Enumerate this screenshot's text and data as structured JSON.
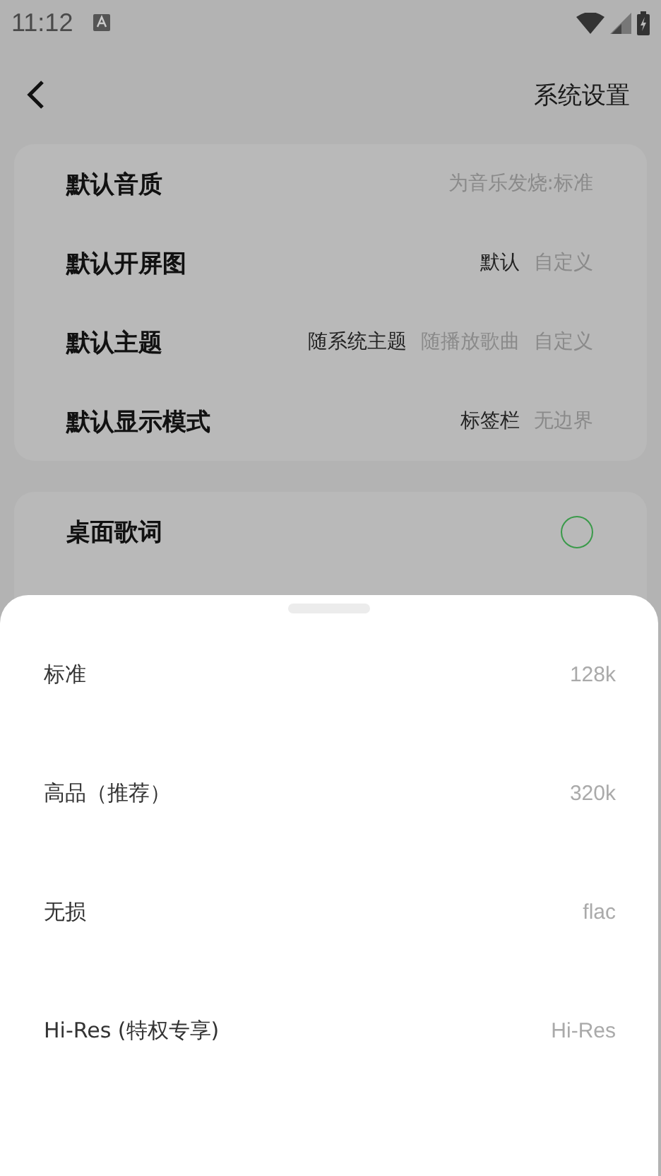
{
  "status_bar": {
    "time": "11:12"
  },
  "header": {
    "title": "系统设置"
  },
  "settings_card": [
    {
      "label": "默认音质",
      "kind": "value",
      "value": "为音乐发烧:标准"
    },
    {
      "label": "默认开屏图",
      "kind": "choice",
      "options": [
        {
          "text": "默认",
          "selected": true
        },
        {
          "text": "自定义",
          "selected": false
        }
      ]
    },
    {
      "label": "默认主题",
      "kind": "choice",
      "options": [
        {
          "text": "随系统主题",
          "selected": true
        },
        {
          "text": "随播放歌曲",
          "selected": false
        },
        {
          "text": "自定义",
          "selected": false
        }
      ]
    },
    {
      "label": "默认显示模式",
      "kind": "choice",
      "options": [
        {
          "text": "标签栏",
          "selected": true
        },
        {
          "text": "无边界",
          "selected": false
        }
      ]
    }
  ],
  "lyrics_card": [
    {
      "label": "桌面歌词",
      "checked": false
    }
  ],
  "quality_sheet": {
    "options": [
      {
        "label": "标准",
        "value": "128k"
      },
      {
        "label": "高品（推荐）",
        "value": "320k"
      },
      {
        "label": "无损",
        "value": "flac"
      },
      {
        "label": "Hi-Res (特权专享)",
        "value": "Hi-Res"
      }
    ]
  }
}
